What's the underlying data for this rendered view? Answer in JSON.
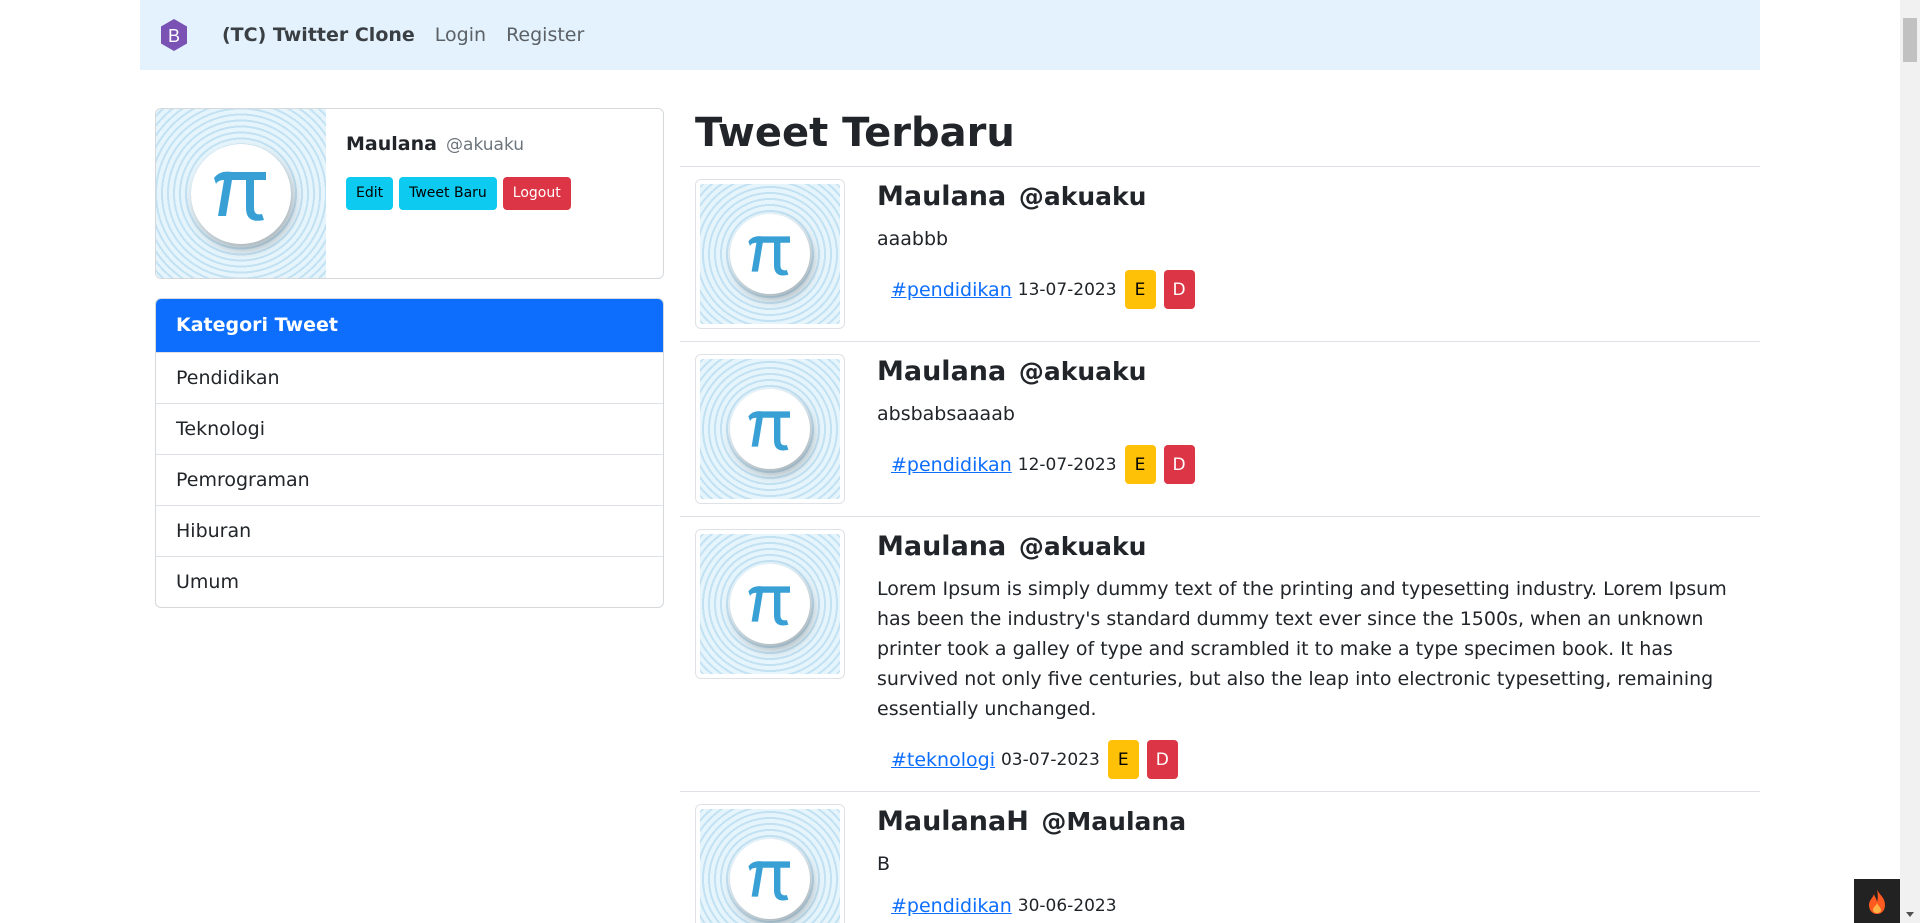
{
  "navbar": {
    "logo_letter": "B",
    "brand": "(TC) Twitter Clone",
    "login": "Login",
    "register": "Register"
  },
  "profile": {
    "name": "Maulana",
    "handle": "@akuaku",
    "buttons": {
      "edit": "Edit",
      "new_tweet": "Tweet Baru",
      "logout": "Logout"
    }
  },
  "categories": {
    "title": "Kategori Tweet",
    "items": [
      "Pendidikan",
      "Teknologi",
      "Pemrograman",
      "Hiburan",
      "Umum"
    ]
  },
  "feed": {
    "title": "Tweet Terbaru",
    "tweets": [
      {
        "name": "Maulana",
        "handle": "@akuaku",
        "text": "aaabbb",
        "hashtag": "#pendidikan",
        "date": "13-07-2023",
        "edit": "E",
        "delete": "D"
      },
      {
        "name": "Maulana",
        "handle": "@akuaku",
        "text": "absbabsaaaab",
        "hashtag": "#pendidikan",
        "date": "12-07-2023",
        "edit": "E",
        "delete": "D"
      },
      {
        "name": "Maulana",
        "handle": "@akuaku",
        "text": "Lorem Ipsum is simply dummy text of the printing and typesetting industry. Lorem Ipsum has been the industry's standard dummy text ever since the 1500s, when an unknown printer took a galley of type and scrambled it to make a type specimen book. It has survived not only five centuries, but also the leap into electronic typesetting, remaining essentially unchanged.",
        "hashtag": "#teknologi",
        "date": "03-07-2023",
        "edit": "E",
        "delete": "D"
      },
      {
        "name": "MaulanaH",
        "handle": "@Maulana",
        "text": "B",
        "hashtag": "#pendidikan",
        "date": "30-06-2023"
      }
    ]
  },
  "colors": {
    "navbar_bg": "#e3f2fd",
    "primary": "#0d6efd",
    "info": "#0dcaf0",
    "danger": "#dc3545",
    "warning": "#ffc107",
    "brand_purple": "#7952b3"
  }
}
